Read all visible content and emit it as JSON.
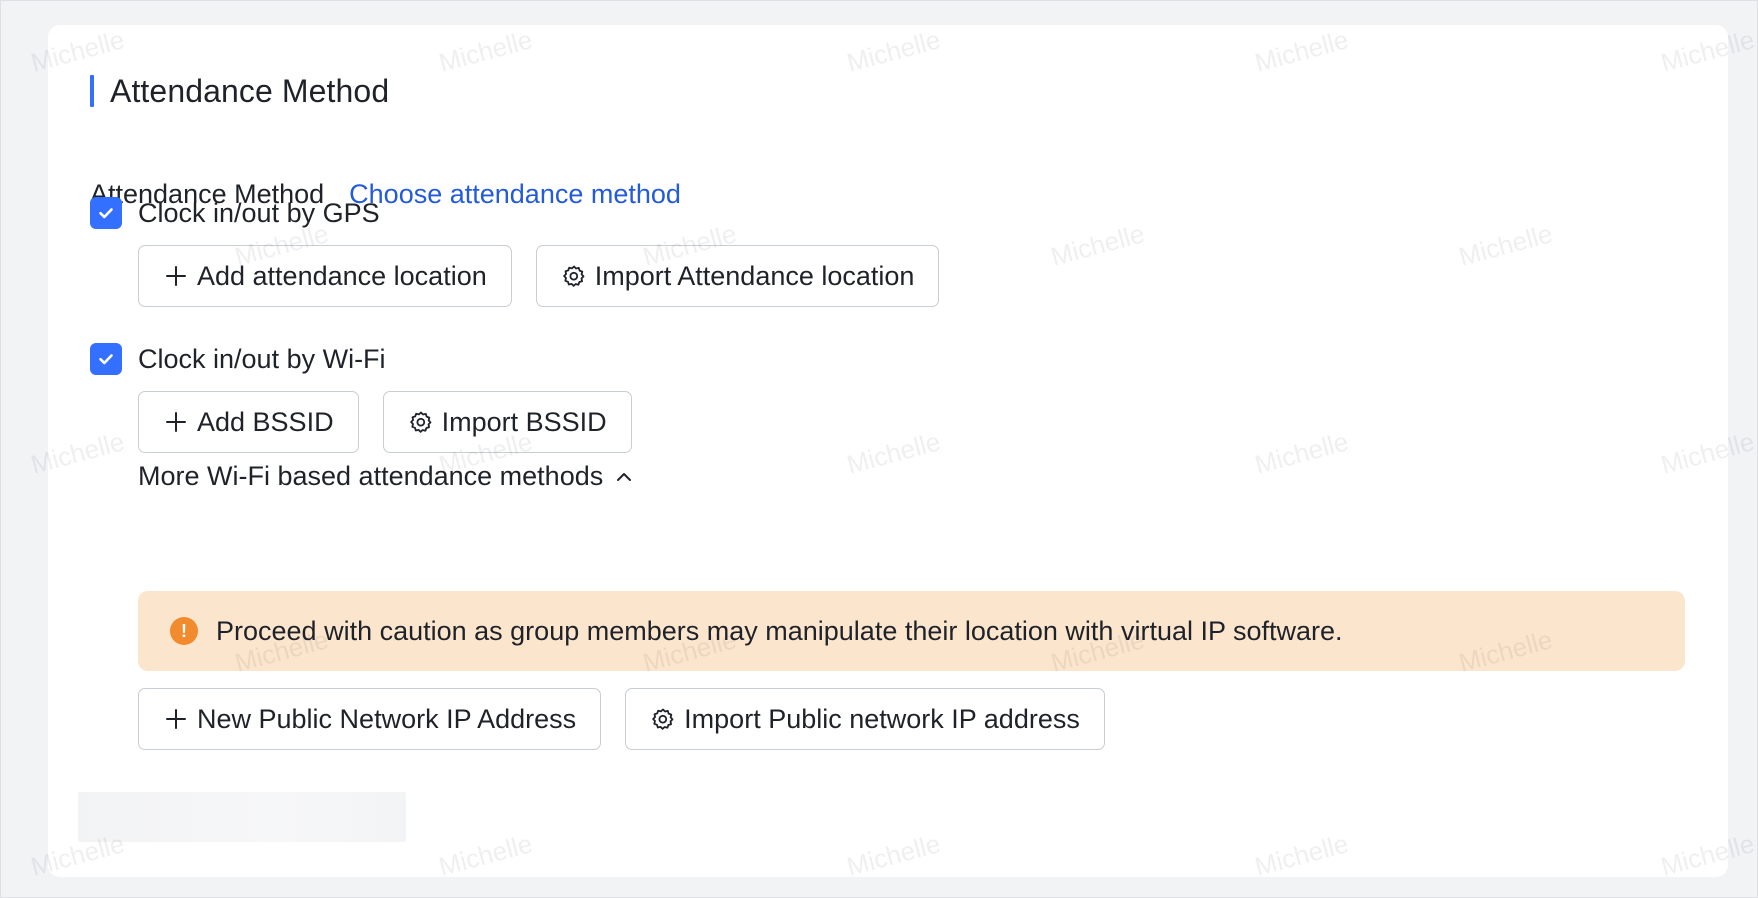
{
  "section": {
    "title": "Attendance Method"
  },
  "method": {
    "label": "Attendance Method",
    "link": "Choose attendance method"
  },
  "gps": {
    "label": "Clock in/out by GPS",
    "checked": true,
    "add_button": "Add attendance location",
    "import_button": "Import Attendance location"
  },
  "wifi": {
    "label": "Clock in/out by Wi-Fi",
    "checked": true,
    "add_button": "Add BSSID",
    "import_button": "Import BSSID",
    "more_label": "More Wi-Fi based attendance methods",
    "more_expanded": true
  },
  "warning": {
    "text": "Proceed with caution as group members may manipulate their location with virtual IP software."
  },
  "public_ip": {
    "add_button": "New Public Network IP Address",
    "import_button": "Import Public network IP address"
  },
  "watermark": {
    "text": "Michelle"
  },
  "colors": {
    "accent": "#3370ff",
    "link": "#245bdb",
    "warning_bg": "#fbe6cd",
    "warning_icon": "#f28a2e"
  },
  "icons": {
    "add": "plus-icon",
    "import": "gear-icon",
    "checkbox": "check-icon",
    "expand": "chevron-up-icon",
    "warning": "exclamation-circle-icon"
  }
}
